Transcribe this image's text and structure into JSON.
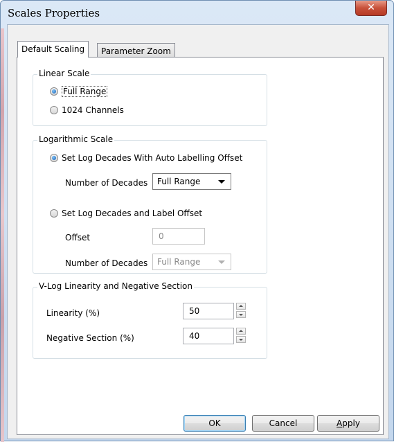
{
  "window": {
    "title": "Scales Properties",
    "close_glyph": "✕"
  },
  "tabs": [
    {
      "label": "Default Scaling",
      "active": true
    },
    {
      "label": "Parameter Zoom",
      "active": false
    }
  ],
  "linear_scale": {
    "legend": "Linear Scale",
    "options": [
      {
        "label": "Full Range",
        "checked": true
      },
      {
        "label": "1024 Channels",
        "checked": false
      }
    ]
  },
  "log_scale": {
    "legend": "Logarithmic Scale",
    "auto_option": {
      "label": "Set Log Decades With Auto Labelling Offset",
      "checked": true
    },
    "auto_decades_label": "Number of Decades",
    "auto_decades_value": "Full Range",
    "manual_option": {
      "label": "Set Log Decades and Label Offset",
      "checked": false
    },
    "offset_label": "Offset",
    "offset_value": "0",
    "manual_decades_label": "Number of Decades",
    "manual_decades_value": "Full Range"
  },
  "vlog": {
    "legend": "V-Log Linearity and Negative Section",
    "linearity_label": "Linearity (%)",
    "linearity_value": "50",
    "negative_label": "Negative Section (%)",
    "negative_value": "40"
  },
  "buttons": {
    "ok": "OK",
    "cancel": "Cancel",
    "apply_first": "A",
    "apply_rest": "pply"
  },
  "colors": {
    "close_button": "#c8513a",
    "default_button_border": "#3c7fb1"
  }
}
